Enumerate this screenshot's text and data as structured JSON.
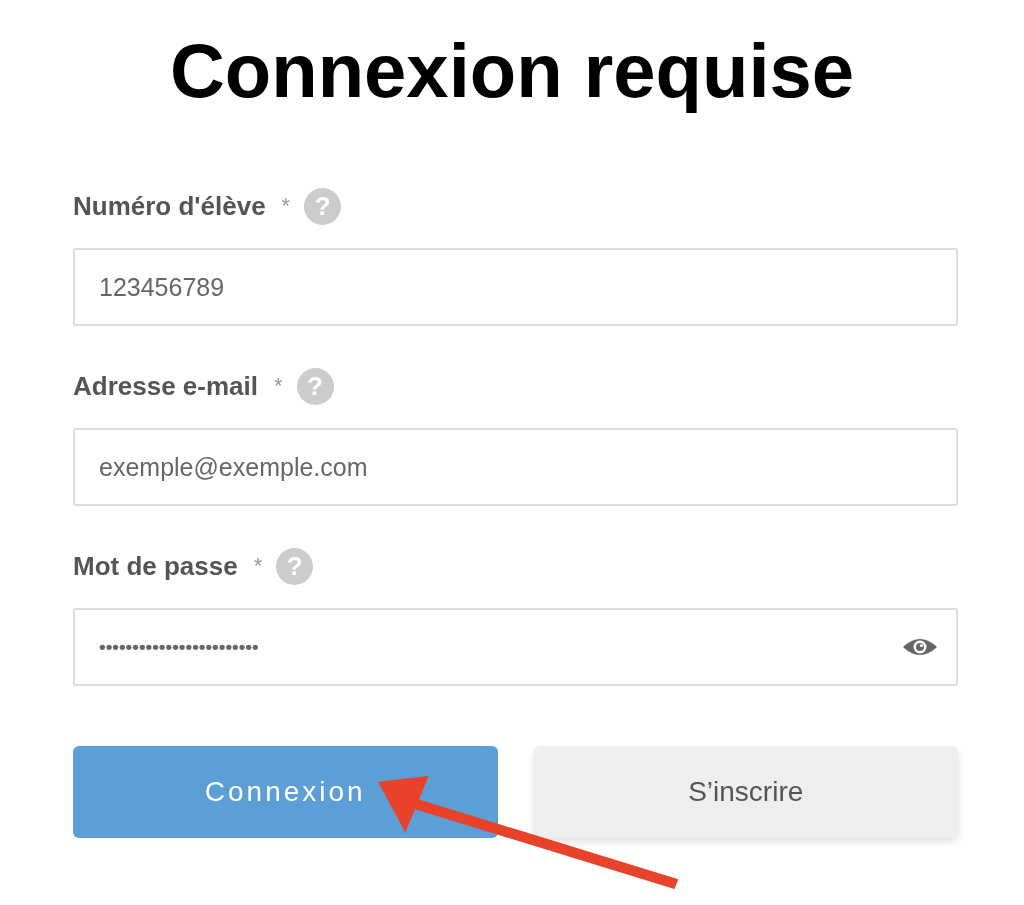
{
  "title": "Connexion requise",
  "fields": [
    {
      "label": "Numéro d'élève",
      "required": "*",
      "help": "?",
      "kind": "text",
      "placeholder": "123456789"
    },
    {
      "label": "Adresse e-mail",
      "required": "*",
      "help": "?",
      "kind": "text",
      "placeholder": "exemple@exemple.com"
    },
    {
      "label": "Mot de passe",
      "required": "*",
      "help": "?",
      "kind": "password",
      "value": "••••••••••••••••••••••••",
      "reveal": true
    }
  ],
  "buttons": [
    {
      "label": "Connexion",
      "kind": "primary"
    },
    {
      "label": "S’inscrire",
      "kind": "secondary"
    }
  ],
  "annotation": {
    "kind": "arrow"
  }
}
